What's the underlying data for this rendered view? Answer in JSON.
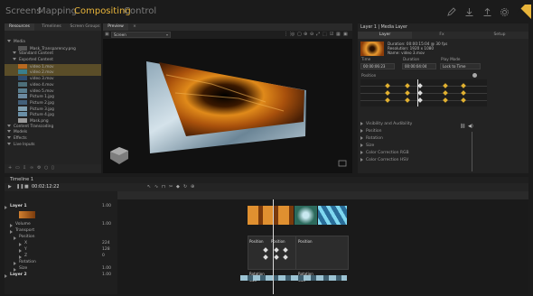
{
  "nav": {
    "items": [
      "Screens",
      "Mapping",
      "Compositing",
      "Control"
    ],
    "active": "Compositing"
  },
  "toolbar_icons": [
    "pencil-icon",
    "download-icon",
    "upload-icon",
    "gear-icon",
    "power-icon"
  ],
  "resources": {
    "tabs": [
      "Resources",
      "Timelines",
      "Screen Groups"
    ],
    "tree": [
      {
        "label": "Media",
        "indent": 0,
        "type": "folder"
      },
      {
        "label": "Mask_Transparency.png",
        "indent": 2,
        "thumb": "#555"
      },
      {
        "label": "Standard Content",
        "indent": 1,
        "type": "folder"
      },
      {
        "label": "Exported Content",
        "indent": 1,
        "type": "folder"
      },
      {
        "label": "video 1.mov",
        "indent": 2,
        "thumb": "#b96a20",
        "selected": true
      },
      {
        "label": "video 2.mov",
        "indent": 2,
        "thumb": "#3b7f8c",
        "selected": true
      },
      {
        "label": "video 3.mov",
        "indent": 2,
        "thumb": "#2e4b6e"
      },
      {
        "label": "video 4.mov",
        "indent": 2,
        "thumb": "#4d6f7a"
      },
      {
        "label": "video 5.mov",
        "indent": 2,
        "thumb": "#5a7e8f"
      },
      {
        "label": "Picture 1.jpg",
        "indent": 2,
        "thumb": "#6b8aa0"
      },
      {
        "label": "Picture 2.jpg",
        "indent": 2,
        "thumb": "#42607a"
      },
      {
        "label": "Picture 3.jpg",
        "indent": 2,
        "thumb": "#7f9fb0"
      },
      {
        "label": "Picture 4.jpg",
        "indent": 2,
        "thumb": "#6a8fa6"
      },
      {
        "label": "Mask.png",
        "indent": 2,
        "thumb": "#999"
      },
      {
        "label": "Content Transcoding",
        "indent": 0,
        "type": "folder"
      },
      {
        "label": "Models",
        "indent": 0,
        "type": "folder"
      },
      {
        "label": "Effects",
        "indent": 0,
        "type": "folder"
      },
      {
        "label": "Live Inputs",
        "indent": 0,
        "type": "folder"
      }
    ]
  },
  "preview": {
    "tab": "Preview",
    "screen_select": "Screen"
  },
  "inspector": {
    "title": "Layer 1 | Media Layer",
    "tabs": [
      "Layer",
      "Fx",
      "Setup"
    ],
    "info_lines": [
      "Duration: 00:00:15:04 @ 30 fps",
      "Resolution: 1920 x 1080",
      "Name: video 3.mov"
    ],
    "time_label": "Time",
    "time_value": "00:00:06:23",
    "duration_label": "Duration",
    "duration_value": "00:00:04:04",
    "playmode_label": "Play Mode",
    "playmode_value": "Lock to Time",
    "position_label": "Position",
    "groups": [
      "Visibility and Audibility",
      "Position",
      "Rotation",
      "Size",
      "Color Correction RGB",
      "Color Correction HSV"
    ]
  },
  "timeline": {
    "title": "Timeline 1",
    "timecode": "00:02:12:22",
    "rows": [
      {
        "label": "Layer 1",
        "bold": true,
        "value": "1.00"
      },
      {
        "label": "Volume",
        "value": "1.00"
      },
      {
        "label": "Transport",
        "value": ""
      },
      {
        "label": "Position",
        "value": ""
      },
      {
        "label": "X",
        "value": "224"
      },
      {
        "label": "Y",
        "value": "128"
      },
      {
        "label": "Z",
        "value": "0"
      },
      {
        "label": "Rotation",
        "value": ""
      },
      {
        "label": "Size",
        "value": "1.00"
      },
      {
        "label": "Layer 2",
        "bold": true,
        "value": "1.00"
      }
    ],
    "clip_labels": [
      "Position",
      "Position",
      "Position",
      "Rotation",
      "Rotation",
      "Size",
      "Size"
    ]
  }
}
